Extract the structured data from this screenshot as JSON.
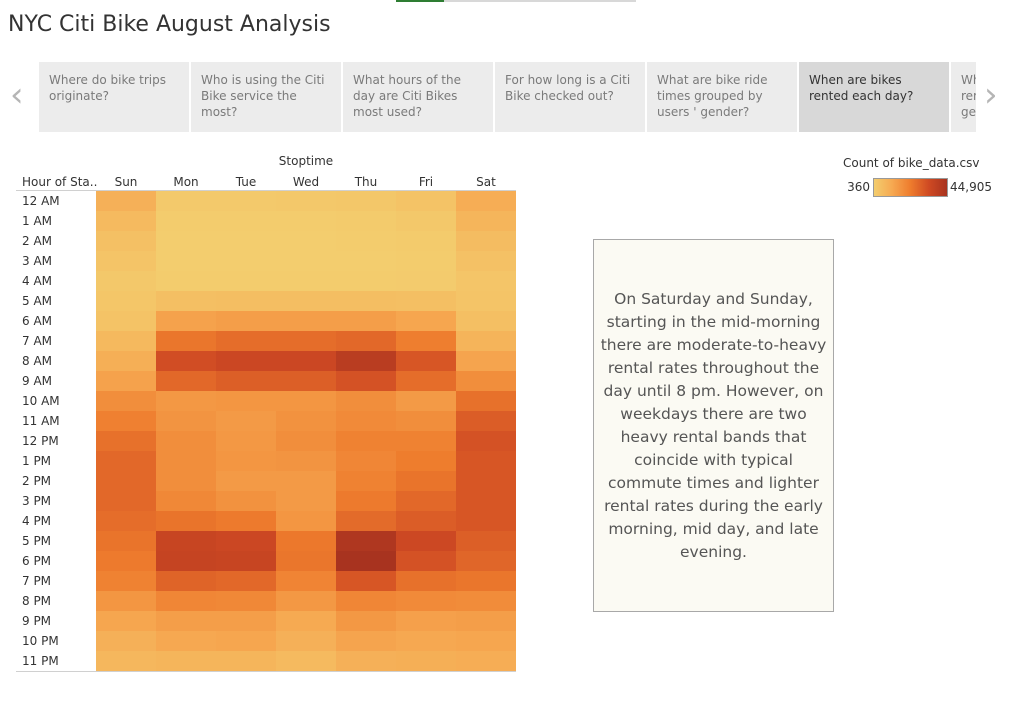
{
  "title": "NYC Citi Bike August Analysis",
  "storypoints": {
    "items": [
      {
        "label": "Where do bike trips originate?",
        "selected": false
      },
      {
        "label": "Who is using the Citi Bike service the most?",
        "selected": false
      },
      {
        "label": "What hours of the day are Citi Bikes most used?",
        "selected": false
      },
      {
        "label": "For how long is a Citi Bike checked out?",
        "selected": false
      },
      {
        "label": "What are bike ride times grouped by users ' gender?",
        "selected": false
      },
      {
        "label": "When are bikes rented each day?",
        "selected": true
      },
      {
        "label": "When are bikes rented each day by gender?",
        "selected": false
      }
    ],
    "prev_icon": "chevron-left-icon",
    "next_icon": "chevron-right-icon"
  },
  "legend": {
    "title": "Count of bike_data.csv",
    "min": "360",
    "max": "44,905"
  },
  "caption": "On Saturday and Sunday, starting in the mid-morning there are moderate-to-heavy rental rates throughout the day until 8 pm. However, on weekdays there are two heavy rental bands that coincide with typical commute times and lighter rental rates during the early morning, mid day, and late evening.",
  "chart_data": {
    "type": "heatmap",
    "column_title": "Stoptime",
    "row_header": "Hour of Sta..",
    "columns": [
      "Sun",
      "Mon",
      "Tue",
      "Wed",
      "Thu",
      "Fri",
      "Sat"
    ],
    "rows": [
      "12 AM",
      "1 AM",
      "2 AM",
      "3 AM",
      "4 AM",
      "5 AM",
      "6 AM",
      "7 AM",
      "8 AM",
      "9 AM",
      "10 AM",
      "11 AM",
      "12 PM",
      "1 PM",
      "2 PM",
      "3 PM",
      "4 PM",
      "5 PM",
      "6 PM",
      "7 PM",
      "8 PM",
      "9 PM",
      "10 PM",
      "11 PM"
    ],
    "value_range": [
      360,
      44905
    ],
    "color_scale": [
      "#f3cd6e",
      "#f6a851",
      "#ee7c2d",
      "#cf4a23",
      "#a8331f"
    ],
    "values": [
      [
        9000,
        1500,
        1500,
        1800,
        2200,
        3500,
        10000
      ],
      [
        6000,
        700,
        700,
        800,
        1000,
        1800,
        7500
      ],
      [
        4200,
        400,
        400,
        450,
        600,
        1100,
        5500
      ],
      [
        3000,
        360,
        360,
        400,
        500,
        800,
        4000
      ],
      [
        2000,
        600,
        600,
        650,
        700,
        900,
        2800
      ],
      [
        2500,
        4500,
        4800,
        4800,
        4900,
        4500,
        3000
      ],
      [
        3500,
        13000,
        14000,
        14000,
        14000,
        12000,
        4500
      ],
      [
        6500,
        24000,
        26000,
        26000,
        27000,
        22000,
        8000
      ],
      [
        9500,
        33000,
        35000,
        35000,
        40000,
        31000,
        12500
      ],
      [
        13000,
        27000,
        29000,
        29000,
        32000,
        26000,
        18000
      ],
      [
        18000,
        15500,
        16000,
        16000,
        18000,
        15000,
        25000
      ],
      [
        21500,
        16500,
        15000,
        17000,
        19000,
        18000,
        29500
      ],
      [
        25000,
        18000,
        15500,
        18000,
        21000,
        21000,
        32000
      ],
      [
        27000,
        18000,
        16000,
        16500,
        20000,
        22500,
        31000
      ],
      [
        27000,
        18000,
        15000,
        15000,
        21000,
        24500,
        31000
      ],
      [
        27000,
        19500,
        17000,
        15000,
        23000,
        27000,
        31000
      ],
      [
        26000,
        24500,
        23000,
        16000,
        26500,
        29500,
        31000
      ],
      [
        24500,
        36000,
        35000,
        23500,
        43000,
        34500,
        29000
      ],
      [
        23000,
        36500,
        36000,
        24000,
        44905,
        32000,
        27500
      ],
      [
        21000,
        28000,
        27000,
        20500,
        31000,
        25000,
        24000
      ],
      [
        16000,
        20000,
        19500,
        15500,
        20000,
        19000,
        18500
      ],
      [
        12000,
        14000,
        14000,
        11000,
        15500,
        13500,
        14000
      ],
      [
        9000,
        11500,
        12000,
        9000,
        12500,
        11500,
        12000
      ],
      [
        7000,
        7500,
        7500,
        6000,
        9000,
        9500,
        10000
      ]
    ]
  }
}
